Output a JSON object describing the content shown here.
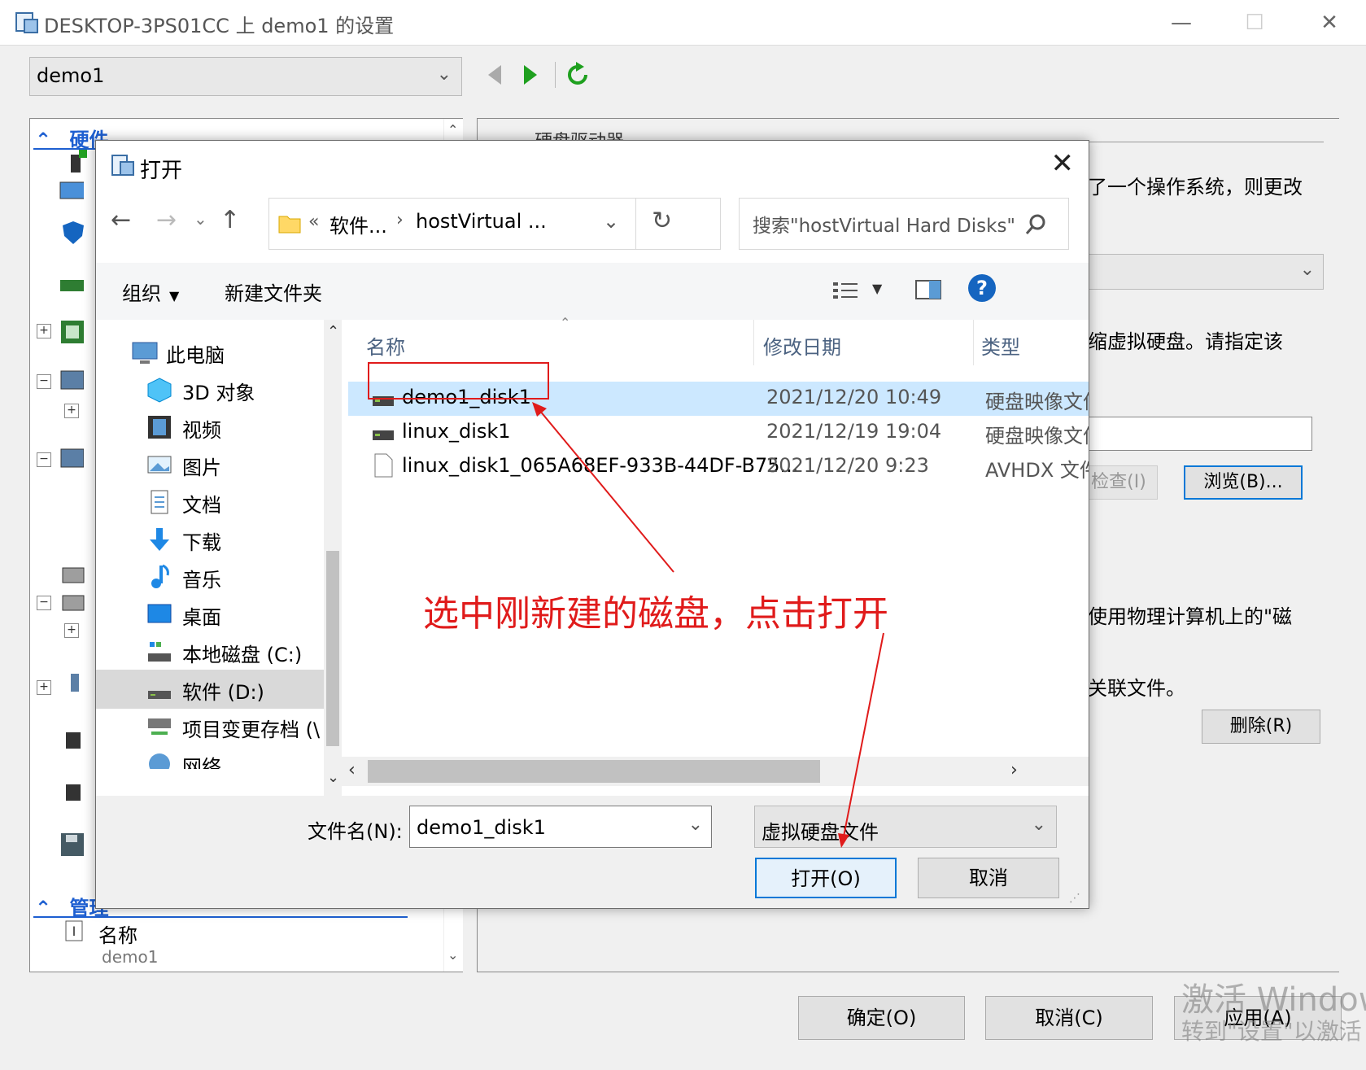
{
  "window": {
    "title": "DESKTOP-3PS01CC 上 demo1 的设置",
    "minimize": "—",
    "maximize": "☐",
    "close": "✕"
  },
  "vm_selector": {
    "value": "demo1"
  },
  "left_panel": {
    "hardware_header": "硬件",
    "management_header": "管理",
    "name_label": "名称",
    "name_value": "demo1"
  },
  "right_panel": {
    "section_title": "硬盘驱动器",
    "fragment_os": "了一个操作系统，则更改",
    "fragment_compress": "缩虚拟硬盘。请指定该",
    "check_button": "检查(I)",
    "browse_button": "浏览(B)...",
    "fragment_physical": "使用物理计算机上的\"磁",
    "fragment_assoc": "关联文件。",
    "delete_button": "删除(R)"
  },
  "bottom_buttons": {
    "ok": "确定(O)",
    "cancel": "取消(C)",
    "apply": "应用(A)"
  },
  "watermark": {
    "line1": "激活 Windows",
    "line2": "转到\"设置\"以激活"
  },
  "dialog": {
    "title": "打开",
    "close": "✕",
    "breadcrumb_prefix": "«",
    "breadcrumb_1": "软件...",
    "breadcrumb_sep": "›",
    "breadcrumb_2": "hostVirtual ...",
    "search_placeholder": "搜索\"hostVirtual Hard Disks\"",
    "organize": "组织",
    "new_folder": "新建文件夹",
    "help": "?",
    "nav_items": [
      {
        "label": "此电脑",
        "icon": "pc-icon"
      },
      {
        "label": "3D 对象",
        "icon": "3d-objects-icon"
      },
      {
        "label": "视频",
        "icon": "video-icon"
      },
      {
        "label": "图片",
        "icon": "pictures-icon"
      },
      {
        "label": "文档",
        "icon": "documents-icon"
      },
      {
        "label": "下载",
        "icon": "download-icon"
      },
      {
        "label": "音乐",
        "icon": "music-icon"
      },
      {
        "label": "桌面",
        "icon": "desktop-icon"
      },
      {
        "label": "本地磁盘 (C:)",
        "icon": "local-disk-icon"
      },
      {
        "label": "软件 (D:)",
        "icon": "drive-icon"
      },
      {
        "label": "项目变更存档 (\\",
        "icon": "network-drive-icon"
      },
      {
        "label": "网络",
        "icon": "network-icon"
      }
    ],
    "columns": {
      "name": "名称",
      "modified": "修改日期",
      "type": "类型"
    },
    "files": [
      {
        "name": "demo1_disk1",
        "modified": "2021/12/20 10:49",
        "type": "硬盘映像文件",
        "icon": "vhd-disk-icon"
      },
      {
        "name": "linux_disk1",
        "modified": "2021/12/19 19:04",
        "type": "硬盘映像文件",
        "icon": "vhd-disk-icon"
      },
      {
        "name": "linux_disk1_065A68EF-933B-44DF-B75...",
        "modified": "2021/12/20 9:23",
        "type": "AVHDX 文件",
        "icon": "file-icon"
      }
    ],
    "filename_label": "文件名(N):",
    "filename_value": "demo1_disk1",
    "filetype_value": "虚拟硬盘文件",
    "open_button": "打开(O)",
    "cancel_button": "取消"
  },
  "annotation": {
    "text": "选中刚新建的磁盘，点击打开",
    "color": "#e01b1b"
  }
}
